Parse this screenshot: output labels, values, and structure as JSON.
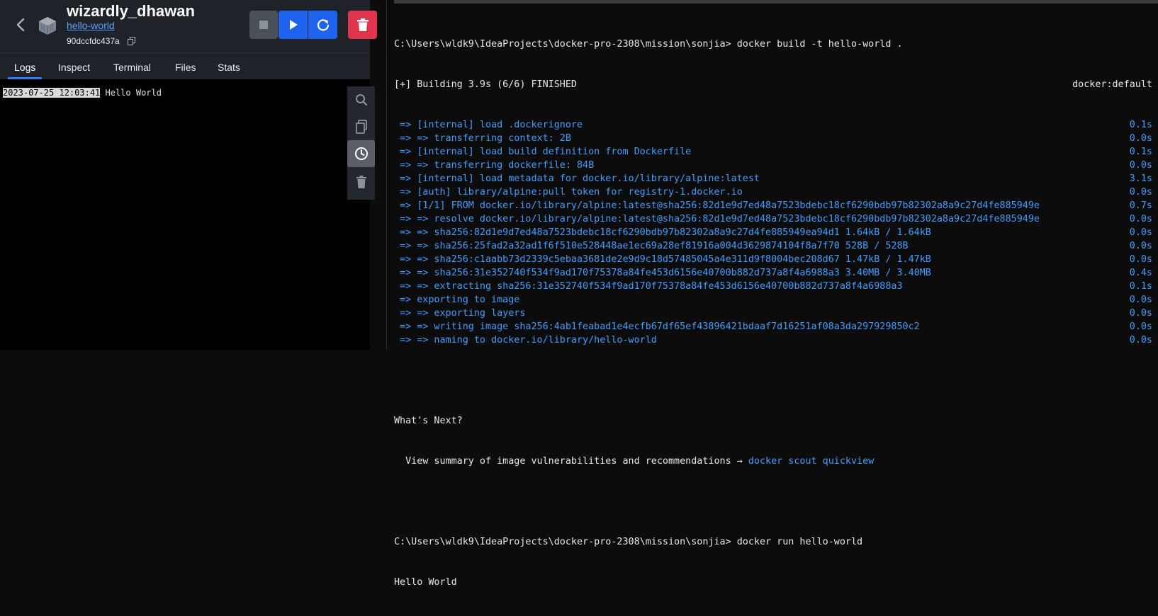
{
  "container": {
    "name": "wizardly_dhawan",
    "image_link": "hello-world",
    "id": "90dccfdc437a"
  },
  "tabs": [
    "Logs",
    "Inspect",
    "Terminal",
    "Files",
    "Stats"
  ],
  "active_tab": "Logs",
  "log": {
    "timestamp": "2023-07-25 12:03:41",
    "message": " Hello World"
  },
  "colors": {
    "accent": "#1d63ed",
    "delete": "#e0354c",
    "link": "#5aa0ff",
    "terminal_blue": "#3e9eff"
  },
  "terminal": {
    "prompt1": "C:\\Users\\wldk9\\IdeaProjects\\docker-pro-2308\\mission\\sonjia> docker build -t hello-world .",
    "build_header": "[+] Building 3.9s (6/6) FINISHED",
    "build_header_right": "docker:default",
    "steps": [
      {
        "text": " => [internal] load .dockerignore",
        "time": "0.1s"
      },
      {
        "text": " => => transferring context: 2B",
        "time": "0.0s"
      },
      {
        "text": " => [internal] load build definition from Dockerfile",
        "time": "0.1s"
      },
      {
        "text": " => => transferring dockerfile: 84B",
        "time": "0.0s"
      },
      {
        "text": " => [internal] load metadata for docker.io/library/alpine:latest",
        "time": "3.1s"
      },
      {
        "text": " => [auth] library/alpine:pull token for registry-1.docker.io",
        "time": "0.0s"
      },
      {
        "text": " => [1/1] FROM docker.io/library/alpine:latest@sha256:82d1e9d7ed48a7523bdebc18cf6290bdb97b82302a8a9c27d4fe885949e",
        "time": "0.7s"
      },
      {
        "text": " => => resolve docker.io/library/alpine:latest@sha256:82d1e9d7ed48a7523bdebc18cf6290bdb97b82302a8a9c27d4fe885949e",
        "time": "0.0s"
      },
      {
        "text": " => => sha256:82d1e9d7ed48a7523bdebc18cf6290bdb97b82302a8a9c27d4fe885949ea94d1 1.64kB / 1.64kB",
        "time": "0.0s"
      },
      {
        "text": " => => sha256:25fad2a32ad1f6f510e528448ae1ec69a28ef81916a004d3629874104f8a7f70 528B / 528B",
        "time": "0.0s"
      },
      {
        "text": " => => sha256:c1aabb73d2339c5ebaa3681de2e9d9c18d57485045a4e311d9f8004bec208d67 1.47kB / 1.47kB",
        "time": "0.0s"
      },
      {
        "text": " => => sha256:31e352740f534f9ad170f75378a84fe453d6156e40700b882d737a8f4a6988a3 3.40MB / 3.40MB",
        "time": "0.4s"
      },
      {
        "text": " => => extracting sha256:31e352740f534f9ad170f75378a84fe453d6156e40700b882d737a8f4a6988a3",
        "time": "0.1s"
      },
      {
        "text": " => exporting to image",
        "time": "0.0s"
      },
      {
        "text": " => => exporting layers",
        "time": "0.0s"
      },
      {
        "text": " => => writing image sha256:4ab1feabad1e4ecfb67df65ef43896421bdaaf7d16251af08a3da297929850c2",
        "time": "0.0s"
      },
      {
        "text": " => => naming to docker.io/library/hello-world",
        "time": "0.0s"
      }
    ],
    "whats_next": "What's Next?",
    "view_summary": "  View summary of image vulnerabilities and recommendations → ",
    "scout_cmd": "docker scout quickview",
    "prompt2": "C:\\Users\\wldk9\\IdeaProjects\\docker-pro-2308\\mission\\sonjia> docker run hello-world",
    "output": "Hello World"
  }
}
